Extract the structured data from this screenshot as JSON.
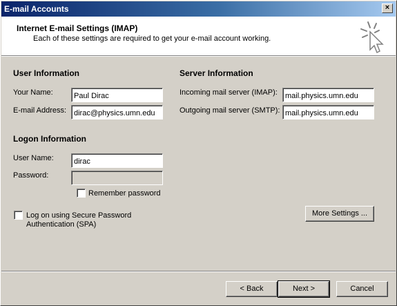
{
  "window": {
    "title": "E-mail Accounts",
    "close_glyph": "×"
  },
  "header": {
    "title": "Internet E-mail Settings (IMAP)",
    "subtitle": "Each of these settings are required to get your e-mail account working."
  },
  "user_info": {
    "heading": "User Information",
    "name_label": "Your Name:",
    "name_value": "Paul Dirac",
    "email_label": "E-mail Address:",
    "email_value": "dirac@physics.umn.edu"
  },
  "server_info": {
    "heading": "Server Information",
    "incoming_label": "Incoming mail server (IMAP):",
    "incoming_value": "mail.physics.umn.edu",
    "outgoing_label": "Outgoing mail server (SMTP):",
    "outgoing_value": "mail.physics.umn.edu"
  },
  "logon_info": {
    "heading": "Logon Information",
    "username_label": "User Name:",
    "username_value": "dirac",
    "password_label": "Password:",
    "password_value": "",
    "remember_label": "Remember password",
    "remember_checked": false
  },
  "spa": {
    "label_line1": "Log on using Secure Password",
    "label_line2": "Authentication (SPA)",
    "checked": false
  },
  "buttons": {
    "more_settings": "More Settings ...",
    "back": "< Back",
    "next": "Next >",
    "cancel": "Cancel"
  },
  "icons": {
    "wizard": "cursor-sparkle-icon",
    "close": "close-icon"
  }
}
